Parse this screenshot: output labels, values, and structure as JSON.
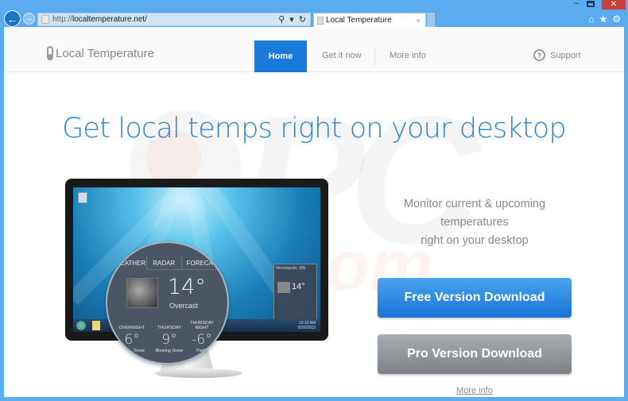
{
  "browser": {
    "url_prefix": "http://",
    "url_domain": "localtemperature.net/",
    "tab_title": "Local Temperature",
    "tab_close": "×",
    "back": "←",
    "forward": "→",
    "search_icon": "⚲",
    "dropdown_icon": "▾",
    "refresh_icon": "↻",
    "min": "–",
    "close": "✕",
    "home_icon": "⌂",
    "star_icon": "★",
    "gear_icon": "⚙"
  },
  "nav": {
    "logo": "Local Temperature",
    "items": [
      "Home",
      "Get it now",
      "More info"
    ],
    "support": "Support",
    "support_icon": "?"
  },
  "hero": {
    "headline": "Get local temps right on your desktop",
    "tagline_lines": [
      "Monitor current & upcoming",
      "temperatures",
      "right on your desktop"
    ]
  },
  "widget": {
    "tabs": [
      "WEATHER",
      "RADAR",
      "FORECAST"
    ],
    "current_temp": "14°",
    "condition": "Overcast",
    "forecast": [
      {
        "label": "OVERNIGHT",
        "temp": "6°",
        "desc": "Snow"
      },
      {
        "label": "THURSDAY",
        "temp": "9°",
        "desc": "Blowing Snow"
      },
      {
        "label": "THURSDAY NIGHT",
        "temp": "-6°",
        "desc": "Partly"
      }
    ],
    "gadget_city": "Minneapolis, MN",
    "gadget_temp": "14°",
    "clock_time": "10:10 AM",
    "clock_date": "9/30/2015"
  },
  "cta": {
    "free": "Free Version Download",
    "pro": "Pro Version Download",
    "more": "More info"
  },
  "watermark": {
    "pc": "PC",
    "com": ".com"
  }
}
